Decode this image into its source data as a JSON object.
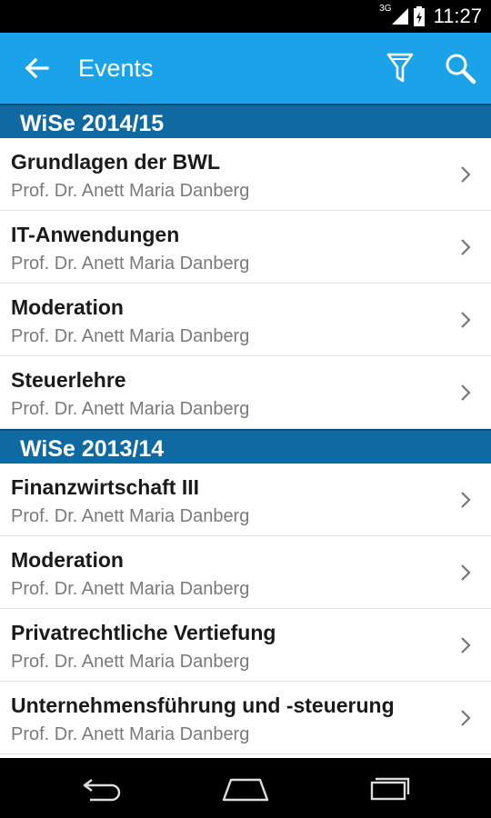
{
  "status": {
    "network": "3G",
    "time": "11:27"
  },
  "appbar": {
    "title": "Events",
    "back_icon": "arrow-left-icon",
    "filter_icon": "filter-icon",
    "search_icon": "search-icon"
  },
  "colors": {
    "appbar": "#1aa3e8",
    "section": "#0f6aa1"
  },
  "sections": [
    {
      "label": "WiSe 2014/15",
      "items": [
        {
          "title": "Grundlagen der BWL",
          "subtitle": "Prof. Dr. Anett Maria Danberg"
        },
        {
          "title": "IT-Anwendungen",
          "subtitle": "Prof. Dr. Anett Maria Danberg"
        },
        {
          "title": "Moderation",
          "subtitle": "Prof. Dr. Anett Maria Danberg"
        },
        {
          "title": "Steuerlehre",
          "subtitle": "Prof. Dr. Anett Maria Danberg"
        }
      ]
    },
    {
      "label": "WiSe 2013/14",
      "items": [
        {
          "title": "Finanzwirtschaft III",
          "subtitle": "Prof. Dr. Anett Maria Danberg"
        },
        {
          "title": "Moderation",
          "subtitle": "Prof. Dr. Anett Maria Danberg"
        },
        {
          "title": "Privatrechtliche Vertiefung",
          "subtitle": "Prof. Dr. Anett Maria Danberg"
        },
        {
          "title": "Unternehmensführung und -steuerung",
          "subtitle": "Prof. Dr. Anett Maria Danberg"
        }
      ]
    }
  ]
}
